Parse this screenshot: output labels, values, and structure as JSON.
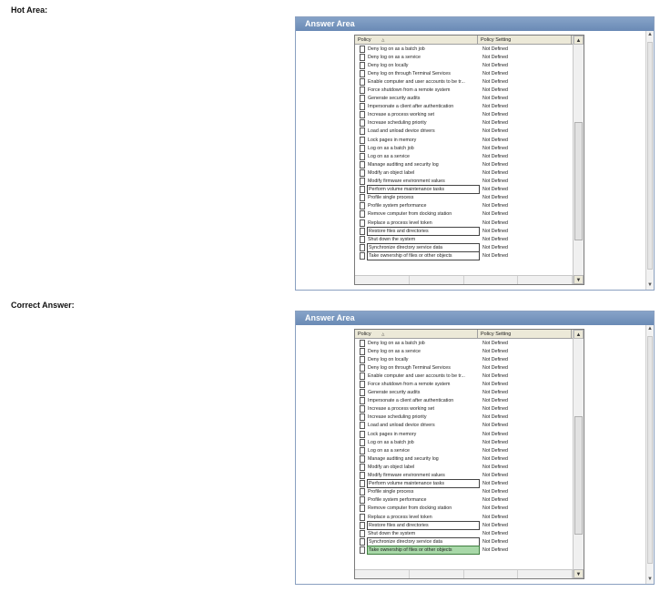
{
  "labels": {
    "hot_area": "Hot Area:",
    "correct_answer": "Correct Answer:"
  },
  "answer_area": {
    "title": "Answer Area",
    "col_policy": "Policy",
    "col_sort_glyph": "△",
    "col_setting": "Policy Setting",
    "scroll_up_glyph": "▲",
    "scroll_down_glyph": "▼"
  },
  "policies": [
    {
      "name": "Deny log on as a batch job",
      "setting": "Not Defined"
    },
    {
      "name": "Deny log on as a service",
      "setting": "Not Defined"
    },
    {
      "name": "Deny log on locally",
      "setting": "Not Defined"
    },
    {
      "name": "Deny log on through Terminal Services",
      "setting": "Not Defined"
    },
    {
      "name": "Enable computer and user accounts to be tr...",
      "setting": "Not Defined"
    },
    {
      "name": "Force shutdown from a remote system",
      "setting": "Not Defined"
    },
    {
      "name": "Generate security audits",
      "setting": "Not Defined"
    },
    {
      "name": "Impersonate a client after authentication",
      "setting": "Not Defined"
    },
    {
      "name": "Increase a process working set",
      "setting": "Not Defined"
    },
    {
      "name": "Increase scheduling priority",
      "setting": "Not Defined"
    },
    {
      "name": "Load and unload device drivers",
      "setting": "Not Defined"
    },
    {
      "name": "Lock pages in memory",
      "setting": "Not Defined"
    },
    {
      "name": "Log on as a batch job",
      "setting": "Not Defined"
    },
    {
      "name": "Log on as a service",
      "setting": "Not Defined"
    },
    {
      "name": "Manage auditing and security log",
      "setting": "Not Defined"
    },
    {
      "name": "Modify an object label",
      "setting": "Not Defined"
    },
    {
      "name": "Modify firmware environment values",
      "setting": "Not Defined"
    },
    {
      "name": "Perform volume maintenance tasks",
      "setting": "Not Defined"
    },
    {
      "name": "Profile single process",
      "setting": "Not Defined"
    },
    {
      "name": "Profile system performance",
      "setting": "Not Defined"
    },
    {
      "name": "Remove computer from docking station",
      "setting": "Not Defined"
    },
    {
      "name": "Replace a process level token",
      "setting": "Not Defined"
    },
    {
      "name": "Restore files and directories",
      "setting": "Not Defined"
    },
    {
      "name": "Shut down the system",
      "setting": "Not Defined"
    },
    {
      "name": "Synchronize directory service data",
      "setting": "Not Defined"
    },
    {
      "name": "Take ownership of files or other objects",
      "setting": "Not Defined"
    }
  ],
  "hot_area_boxed_rows": [
    17,
    22,
    24,
    25
  ],
  "correct_answer": {
    "boxed_rows": [
      17,
      22,
      24
    ],
    "selected_rows": [
      25
    ]
  },
  "colors": {
    "header_bar": "#6f8fba",
    "selected_fill": "#a8d8a8"
  }
}
